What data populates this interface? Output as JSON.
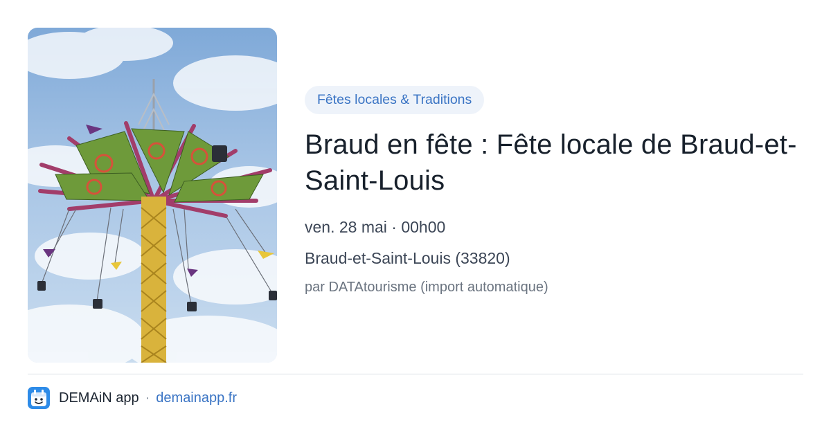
{
  "event": {
    "image_alt": "Swing ride at a fair against a blue sky",
    "category": "Fêtes locales & Traditions",
    "title": "Braud en fête : Fête locale de Braud-et-Saint-Louis",
    "date": "ven. 28 mai · 00h00",
    "location": "Braud-et-Saint-Louis (33820)",
    "source": "par DATAtourisme (import automatique)"
  },
  "footer": {
    "app_name": "DEMAiN app",
    "separator": "·",
    "url": "demainapp.fr"
  },
  "colors": {
    "accent": "#3a74c4",
    "pill_background": "#eef3fa",
    "title": "#17202b",
    "body_text": "#3c4656",
    "muted_text": "#6b7480",
    "logo_blue": "#2d8be8"
  }
}
